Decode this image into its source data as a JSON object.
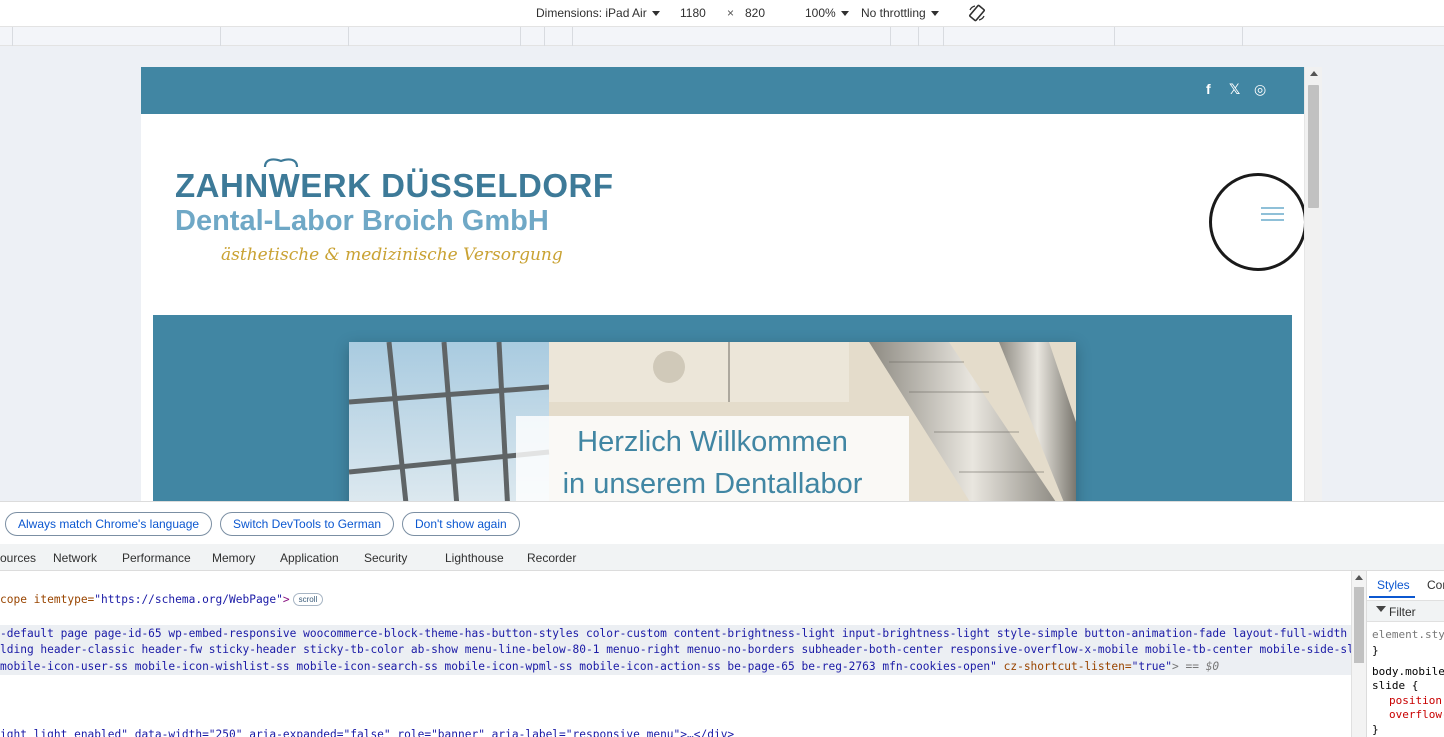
{
  "device_toolbar": {
    "dimensions_label": "Dimensions: iPad Air",
    "width": "1180",
    "times": "×",
    "height": "820",
    "zoom": "100%",
    "throttling": "No throttling"
  },
  "site": {
    "social_icons": [
      "facebook-icon",
      "x-icon",
      "instagram-icon"
    ],
    "social_glyphs": [
      "f",
      "𝕏",
      "◎"
    ],
    "logo": {
      "line1": "ZAHNWERK DÜSSELDORF",
      "line2": "Dental-Labor Broich GmbH",
      "line3": "ästhetische & medizinische Versorgung"
    },
    "hero": {
      "line1": "Herzlich Willkommen",
      "line2": "in unserem Dentallabor"
    },
    "colors": {
      "brand_blue": "#4186a3",
      "logo_dark": "#3d7a98",
      "logo_light": "#6fa8c6",
      "logo_gold": "#c9a233"
    }
  },
  "infobar": {
    "btn_match": "Always match Chrome's language",
    "btn_switch": "Switch DevTools to German",
    "btn_dont_show": "Don't show again"
  },
  "devtools_tabs": [
    "ources",
    "Network",
    "Performance",
    "Memory",
    "Application",
    "Security",
    "Lighthouse",
    "Recorder"
  ],
  "elements": {
    "line1_pre": "cope itemtype=",
    "line1_val": "\"https://schema.org/WebPage\"",
    "line1_post": ">",
    "scroll_badge": "scroll",
    "line2": "-default page page-id-65 wp-embed-responsive woocommerce-block-theme-has-button-styles color-custom content-brightness-light input-brightness-light style-simple button-animation-fade layout-full-width one",
    "line3": "lding header-classic header-fw sticky-header sticky-tb-color ab-show menu-line-below-80-1 menuo-right menuo-no-borders subheader-both-center responsive-overflow-x-mobile mobile-tb-center mobile-side-slide",
    "line4_val": "mobile-icon-user-ss mobile-icon-wishlist-ss mobile-icon-search-ss mobile-icon-wpml-ss mobile-icon-action-ss be-page-65 be-reg-2763 mfn-cookies-open\"",
    "line4_attr": "cz-shortcut-listen=",
    "line4_attr_val": "\"true\"",
    "line4_end": "> == $0",
    "line5": "ight light enabled\" data-width=\"250\" aria-expanded=\"false\" role=\"banner\" aria-label=\"responsive menu\">…</div>"
  },
  "styles_panel": {
    "tab_styles": "Styles",
    "tab_computed": "Cor",
    "filter": "Filter",
    "element_style": "element.sty",
    "close1": "}",
    "selector1": "body.mobile",
    "selector2": "slide {",
    "prop1": "position",
    "prop2": "overflow-",
    "close2": "}"
  }
}
